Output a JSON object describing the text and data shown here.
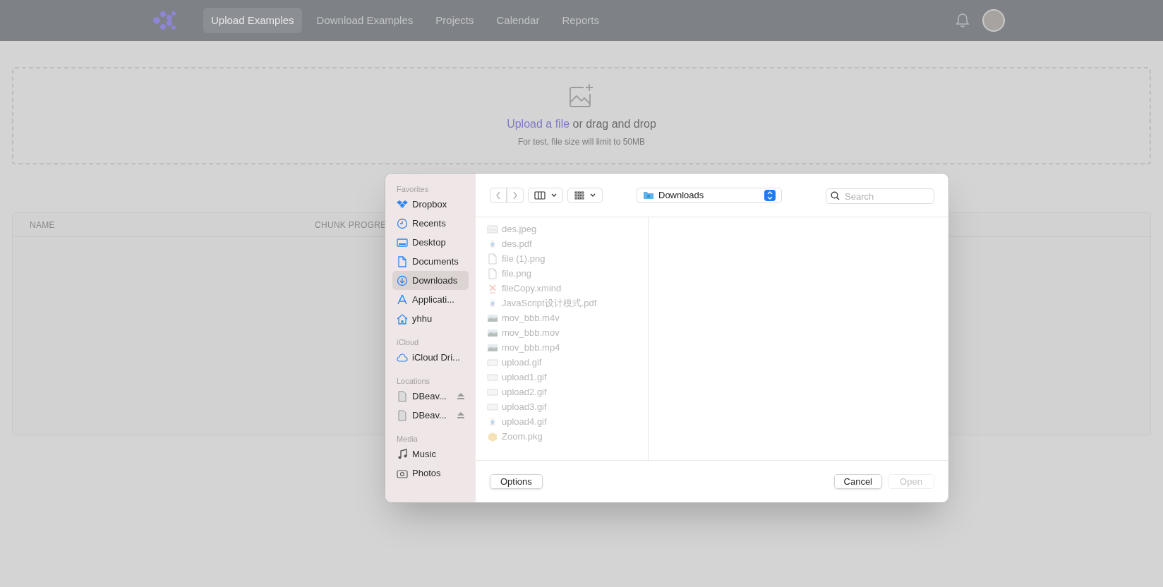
{
  "nav": {
    "items": [
      {
        "label": "Upload Examples",
        "selected": true
      },
      {
        "label": "Download Examples",
        "selected": false
      },
      {
        "label": "Projects",
        "selected": false
      },
      {
        "label": "Calendar",
        "selected": false
      },
      {
        "label": "Reports",
        "selected": false
      }
    ]
  },
  "upload": {
    "link": "Upload a file",
    "text": "or drag and drop",
    "hint": "For test, file size will limit to 50MB"
  },
  "table": {
    "columns": [
      "NAME",
      "CHUNK PROGRE"
    ]
  },
  "dialog": {
    "sidebar": [
      {
        "heading": "Favorites",
        "items": [
          {
            "label": "Dropbox",
            "kind": "dropbox",
            "selected": false
          },
          {
            "label": "Recents",
            "kind": "clock",
            "selected": false
          },
          {
            "label": "Desktop",
            "kind": "desktop",
            "selected": false
          },
          {
            "label": "Documents",
            "kind": "document",
            "selected": false
          },
          {
            "label": "Downloads",
            "kind": "download",
            "selected": true
          },
          {
            "label": "Applicati...",
            "kind": "apps",
            "selected": false
          },
          {
            "label": "yhhu",
            "kind": "home",
            "selected": false
          }
        ]
      },
      {
        "heading": "iCloud",
        "items": [
          {
            "label": "iCloud Dri...",
            "kind": "cloud",
            "selected": false
          }
        ]
      },
      {
        "heading": "Locations",
        "items": [
          {
            "label": "DBeav...",
            "kind": "disk",
            "selected": false,
            "eject": true
          },
          {
            "label": "DBeav...",
            "kind": "disk",
            "selected": false,
            "eject": true
          }
        ]
      },
      {
        "heading": "Media",
        "items": [
          {
            "label": "Music",
            "kind": "music",
            "selected": false
          },
          {
            "label": "Photos",
            "kind": "photo",
            "selected": false
          }
        ]
      }
    ],
    "location": "Downloads",
    "search_placeholder": "Search",
    "files": [
      {
        "name": "des.jpeg",
        "kind": "image",
        "disabled": true
      },
      {
        "name": "des.pdf",
        "kind": "pdf",
        "disabled": true
      },
      {
        "name": "file (1).png",
        "kind": "doc",
        "disabled": true
      },
      {
        "name": "file.png",
        "kind": "doc",
        "disabled": true
      },
      {
        "name": "fileCopy.xmind",
        "kind": "xmind",
        "disabled": true
      },
      {
        "name": "JavaScript设计模式.pdf",
        "kind": "pdf",
        "disabled": true
      },
      {
        "name": "mov_bbb.m4v",
        "kind": "video",
        "disabled": true
      },
      {
        "name": "mov_bbb.mov",
        "kind": "video",
        "disabled": true
      },
      {
        "name": "mov_bbb.mp4",
        "kind": "video",
        "disabled": true
      },
      {
        "name": "upload.gif",
        "kind": "gif",
        "disabled": true
      },
      {
        "name": "upload1.gif",
        "kind": "gif",
        "disabled": true
      },
      {
        "name": "upload2.gif",
        "kind": "gif",
        "disabled": true
      },
      {
        "name": "upload3.gif",
        "kind": "gif",
        "disabled": true
      },
      {
        "name": "upload4.gif",
        "kind": "pdf",
        "disabled": true
      },
      {
        "name": "Zoom.pkg",
        "kind": "package",
        "disabled": true
      }
    ],
    "buttons": [
      {
        "label": "Options",
        "disabled": false
      },
      {
        "label": "Cancel",
        "disabled": false
      },
      {
        "label": "Open",
        "disabled": true
      }
    ]
  }
}
